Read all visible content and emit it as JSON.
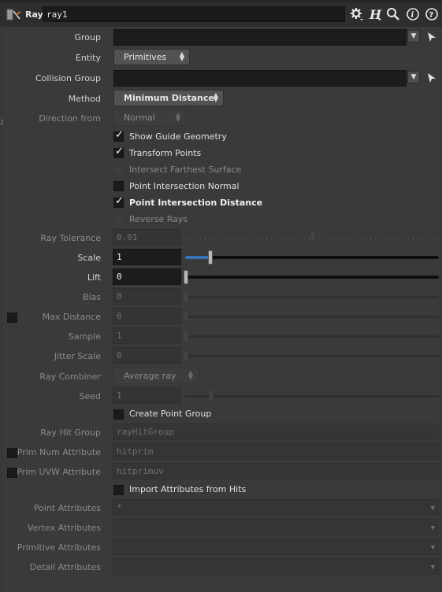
{
  "header": {
    "node_type": "Ray",
    "node_name": "ray1",
    "icons": [
      "gear-icon",
      "help-h-icon",
      "search-icon",
      "info-icon",
      "question-icon"
    ]
  },
  "params": {
    "group": {
      "label": "Group",
      "value": ""
    },
    "entity": {
      "label": "Entity",
      "value": "Primitives"
    },
    "collision_group": {
      "label": "Collision Group",
      "value": ""
    },
    "method": {
      "label": "Method",
      "value": "Minimum Distance"
    },
    "direction_from": {
      "label": "Direction from",
      "value": "Normal"
    },
    "show_guide": {
      "label": "Show Guide Geometry",
      "checked": true
    },
    "transform_points": {
      "label": "Transform Points",
      "checked": true
    },
    "intersect_farthest": {
      "label": "Intersect Farthest Surface",
      "checked": false
    },
    "point_intersection_normal": {
      "label": "Point Intersection Normal",
      "checked": false
    },
    "point_intersection_distance": {
      "label": "Point Intersection Distance",
      "checked": true
    },
    "reverse_rays": {
      "label": "Reverse Rays",
      "checked": false
    },
    "ray_tolerance": {
      "label": "Ray Tolerance",
      "value": "0.01"
    },
    "scale": {
      "label": "Scale",
      "value": "1",
      "slider": 0.1
    },
    "lift": {
      "label": "Lift",
      "value": "0",
      "slider": 0.0
    },
    "bias": {
      "label": "Bias",
      "value": "0"
    },
    "max_distance": {
      "label": "Max Distance",
      "value": "0"
    },
    "sample": {
      "label": "Sample",
      "value": "1"
    },
    "jitter_scale": {
      "label": "Jitter Scale",
      "value": "0"
    },
    "ray_combiner": {
      "label": "Ray Combiner",
      "value": "Average ray"
    },
    "seed": {
      "label": "Seed",
      "value": "1"
    },
    "create_point_group": {
      "label": "Create Point Group",
      "checked": false
    },
    "ray_hit_group": {
      "label": "Ray Hit Group",
      "value": "rayHitGroup"
    },
    "prim_num_attr": {
      "label": "Prim Num Attribute",
      "value": "hitprim"
    },
    "prim_uvw_attr": {
      "label": "Prim UVW Attribute",
      "value": "hitprimuv"
    },
    "import_attrs": {
      "label": "Import Attributes from Hits",
      "checked": false
    },
    "point_attributes": {
      "label": "Point Attributes",
      "value": "*"
    },
    "vertex_attributes": {
      "label": "Vertex Attributes",
      "value": ""
    },
    "primitive_attributes": {
      "label": "Primitive Attributes",
      "value": ""
    },
    "detail_attributes": {
      "label": "Detail Attributes",
      "value": ""
    }
  },
  "side_marker": "2",
  "colors": {
    "accent": "#3a72b8",
    "background": "#3a3a3a",
    "field": "#1c1c1c"
  }
}
